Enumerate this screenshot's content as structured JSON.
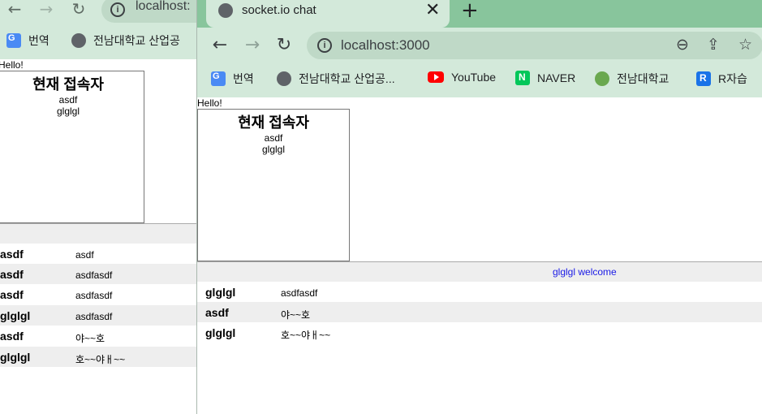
{
  "back_window": {
    "url": "localhost:",
    "bookmarks": [
      {
        "label": "번역",
        "icon": "translate-icon"
      },
      {
        "label": "전남대학교 산업공",
        "icon": "globe-icon"
      }
    ],
    "page": {
      "hello": "Hello!",
      "users_title": "현재 접속자",
      "users": [
        "asdf",
        "glglgl"
      ],
      "messages": [
        {
          "name": "asdf",
          "text": "asdf"
        },
        {
          "name": "asdf",
          "text": "asdfasdf"
        },
        {
          "name": "asdf",
          "text": "asdfasdf"
        },
        {
          "name": "glglgl",
          "text": "asdfasdf"
        },
        {
          "name": "asdf",
          "text": "야~~호"
        },
        {
          "name": "glglgl",
          "text": "호~~야ㅐ~~"
        }
      ]
    }
  },
  "front_window": {
    "tab_title": "socket.io chat",
    "url": "localhost:3000",
    "bookmarks": [
      {
        "label": "번역",
        "icon": "translate-icon"
      },
      {
        "label": "전남대학교 산업공...",
        "icon": "globe-icon"
      },
      {
        "label": "YouTube",
        "icon": "youtube-icon"
      },
      {
        "label": "NAVER",
        "icon": "naver-icon"
      },
      {
        "label": "전남대학교",
        "icon": "cnu-icon"
      },
      {
        "label": "R자습",
        "icon": "r-icon"
      }
    ],
    "page": {
      "hello": "Hello!",
      "users_title": "현재 접속자",
      "users": [
        "asdf",
        "glglgl"
      ],
      "system_message": "glglgl welcome",
      "messages": [
        {
          "name": "glglgl",
          "text": "asdfasdf"
        },
        {
          "name": "asdf",
          "text": "야~~호"
        },
        {
          "name": "glglgl",
          "text": "호~~야ㅐ~~"
        }
      ]
    }
  }
}
